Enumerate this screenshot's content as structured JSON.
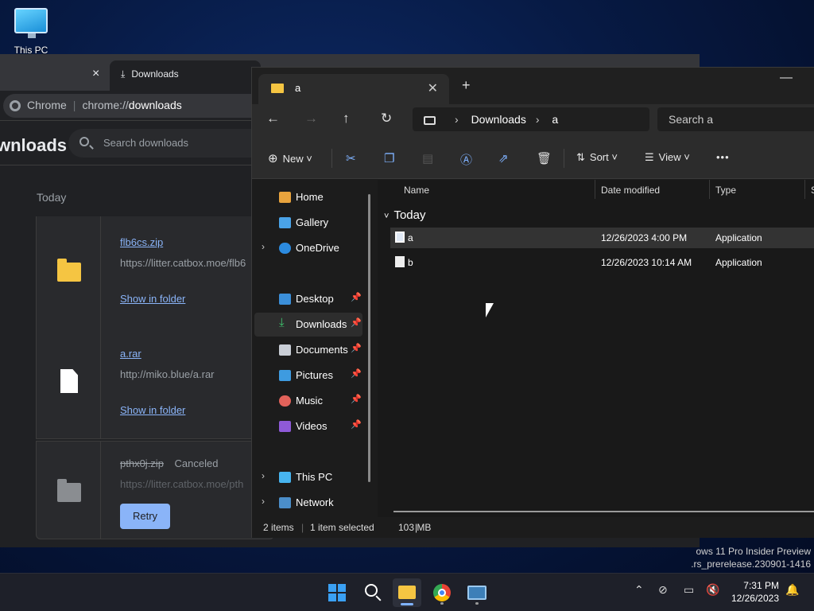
{
  "desktop": {
    "this_pc_label": "This PC"
  },
  "chrome": {
    "tab_title": "Downloads",
    "tab_close": "×",
    "omnibox_site": "Chrome",
    "omnibox_url_prefix": "chrome://",
    "omnibox_url_page": "downloads",
    "page_title": "wnloads",
    "search_placeholder": "Search downloads",
    "group_label": "Today",
    "downloads": [
      {
        "name": "flb6cs.zip",
        "url": "https://litter.catbox.moe/flb6",
        "action": "Show in folder"
      },
      {
        "name": "a.rar",
        "url": "http://miko.blue/a.rar",
        "action": "Show in folder"
      },
      {
        "name": "pthx0j.zip",
        "status": "Canceled",
        "url": "https://litter.catbox.moe/pth",
        "action": "Retry"
      }
    ]
  },
  "explorer": {
    "tab_title": "a",
    "tab_close": "✕",
    "new_tab": "+",
    "breadcrumb": [
      "Downloads",
      "a"
    ],
    "search_placeholder": "Search a",
    "commands": {
      "new": "New",
      "sort": "Sort",
      "view": "View",
      "more": "•••"
    },
    "nav": [
      {
        "label": "Home"
      },
      {
        "label": "Gallery"
      },
      {
        "label": "OneDrive",
        "expand": "›"
      },
      {
        "label": "Desktop",
        "pinned": true
      },
      {
        "label": "Downloads",
        "pinned": true,
        "selected": true
      },
      {
        "label": "Documents",
        "pinned": true
      },
      {
        "label": "Pictures",
        "pinned": true
      },
      {
        "label": "Music",
        "pinned": true
      },
      {
        "label": "Videos",
        "pinned": true
      },
      {
        "label": "This PC",
        "expand": "›"
      },
      {
        "label": "Network",
        "expand": "›"
      }
    ],
    "columns": [
      "Name",
      "Date modified",
      "Type",
      "S"
    ],
    "group": "Today",
    "files": [
      {
        "name": "a",
        "date": "12/26/2023 4:00 PM",
        "type": "Application",
        "selected": true
      },
      {
        "name": "b",
        "date": "12/26/2023 10:14 AM",
        "type": "Application"
      }
    ],
    "status": {
      "count": "2 items",
      "selection": "1 item selected",
      "size": "103 MB"
    }
  },
  "watermark": {
    "line1": "ows 11 Pro Insider Preview",
    "line2": ".rs_prerelease.230901-1416"
  },
  "taskbar": {
    "time": "7:31 PM",
    "date": "12/26/2023"
  },
  "colors": {
    "accent": "#7fb2ff",
    "chrome_link": "#8ab4f8",
    "folder": "#f5c542"
  }
}
